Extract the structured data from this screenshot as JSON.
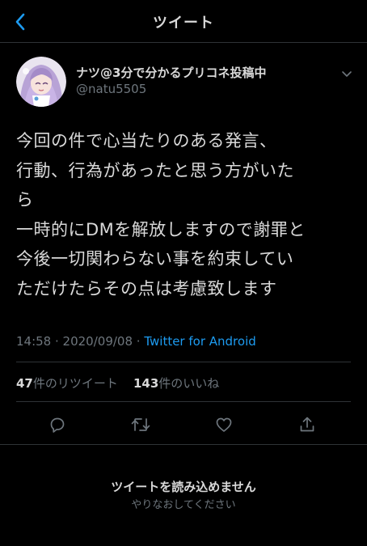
{
  "header": {
    "title": "ツイート",
    "back_icon": "chevron-left-icon"
  },
  "colors": {
    "background": "#000000",
    "text": "#d9d9d9",
    "secondary_text": "#6e767d",
    "accent": "#1d9bf0",
    "border": "#2f3336"
  },
  "tweet": {
    "author": {
      "display_name": "ナツ@3分で分かるプリコネ投稿中",
      "handle": "@natu5505",
      "avatar_icon": "avatar-anime-character"
    },
    "text_lines": [
      "今回の件で心当たりのある発言、",
      "行動、行為があったと思う方がいた",
      "ら",
      "一時的にDMを解放しますので謝罪と",
      "今後一切関わらない事を約束してい",
      "ただけたらその点は考慮致します"
    ],
    "time": "14:58",
    "separator": " · ",
    "date": "2020/09/08",
    "source": "Twitter for Android",
    "retweets": {
      "count": "47",
      "label": "件のリツイート"
    },
    "likes": {
      "count": "143",
      "label": "件のいいね"
    }
  },
  "actions": [
    {
      "name": "reply",
      "icon": "reply-icon"
    },
    {
      "name": "retweet",
      "icon": "retweet-icon"
    },
    {
      "name": "like",
      "icon": "heart-icon"
    },
    {
      "name": "share",
      "icon": "share-icon"
    }
  ],
  "load_error": {
    "title": "ツイートを読み込めません",
    "retry": "やりなおしてください"
  }
}
